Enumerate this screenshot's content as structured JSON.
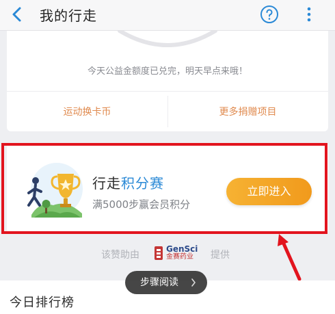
{
  "header": {
    "title": "我的行走"
  },
  "charity_card": {
    "notice": "今天公益金额度已兑完，明天早点来哦！",
    "actions": [
      "运动换卡币",
      "更多捐赠项目"
    ]
  },
  "promo": {
    "title_plain": "行走",
    "title_highlight": "积分赛",
    "subtitle": "满5000步赢会员积分",
    "button_label": "立即进入"
  },
  "sponsor": {
    "prefix": "该赞助由",
    "logo_en": "GenSci",
    "logo_cn": "金赛药业",
    "suffix": "提供"
  },
  "floating_button": {
    "label": "步骤阅读"
  },
  "ranking": {
    "title": "今日排行榜"
  },
  "colors": {
    "accent_blue": "#2a89d6",
    "action_orange": "#e08a4e",
    "highlight_red": "#e2141e",
    "button_orange": "#f19a1c"
  }
}
